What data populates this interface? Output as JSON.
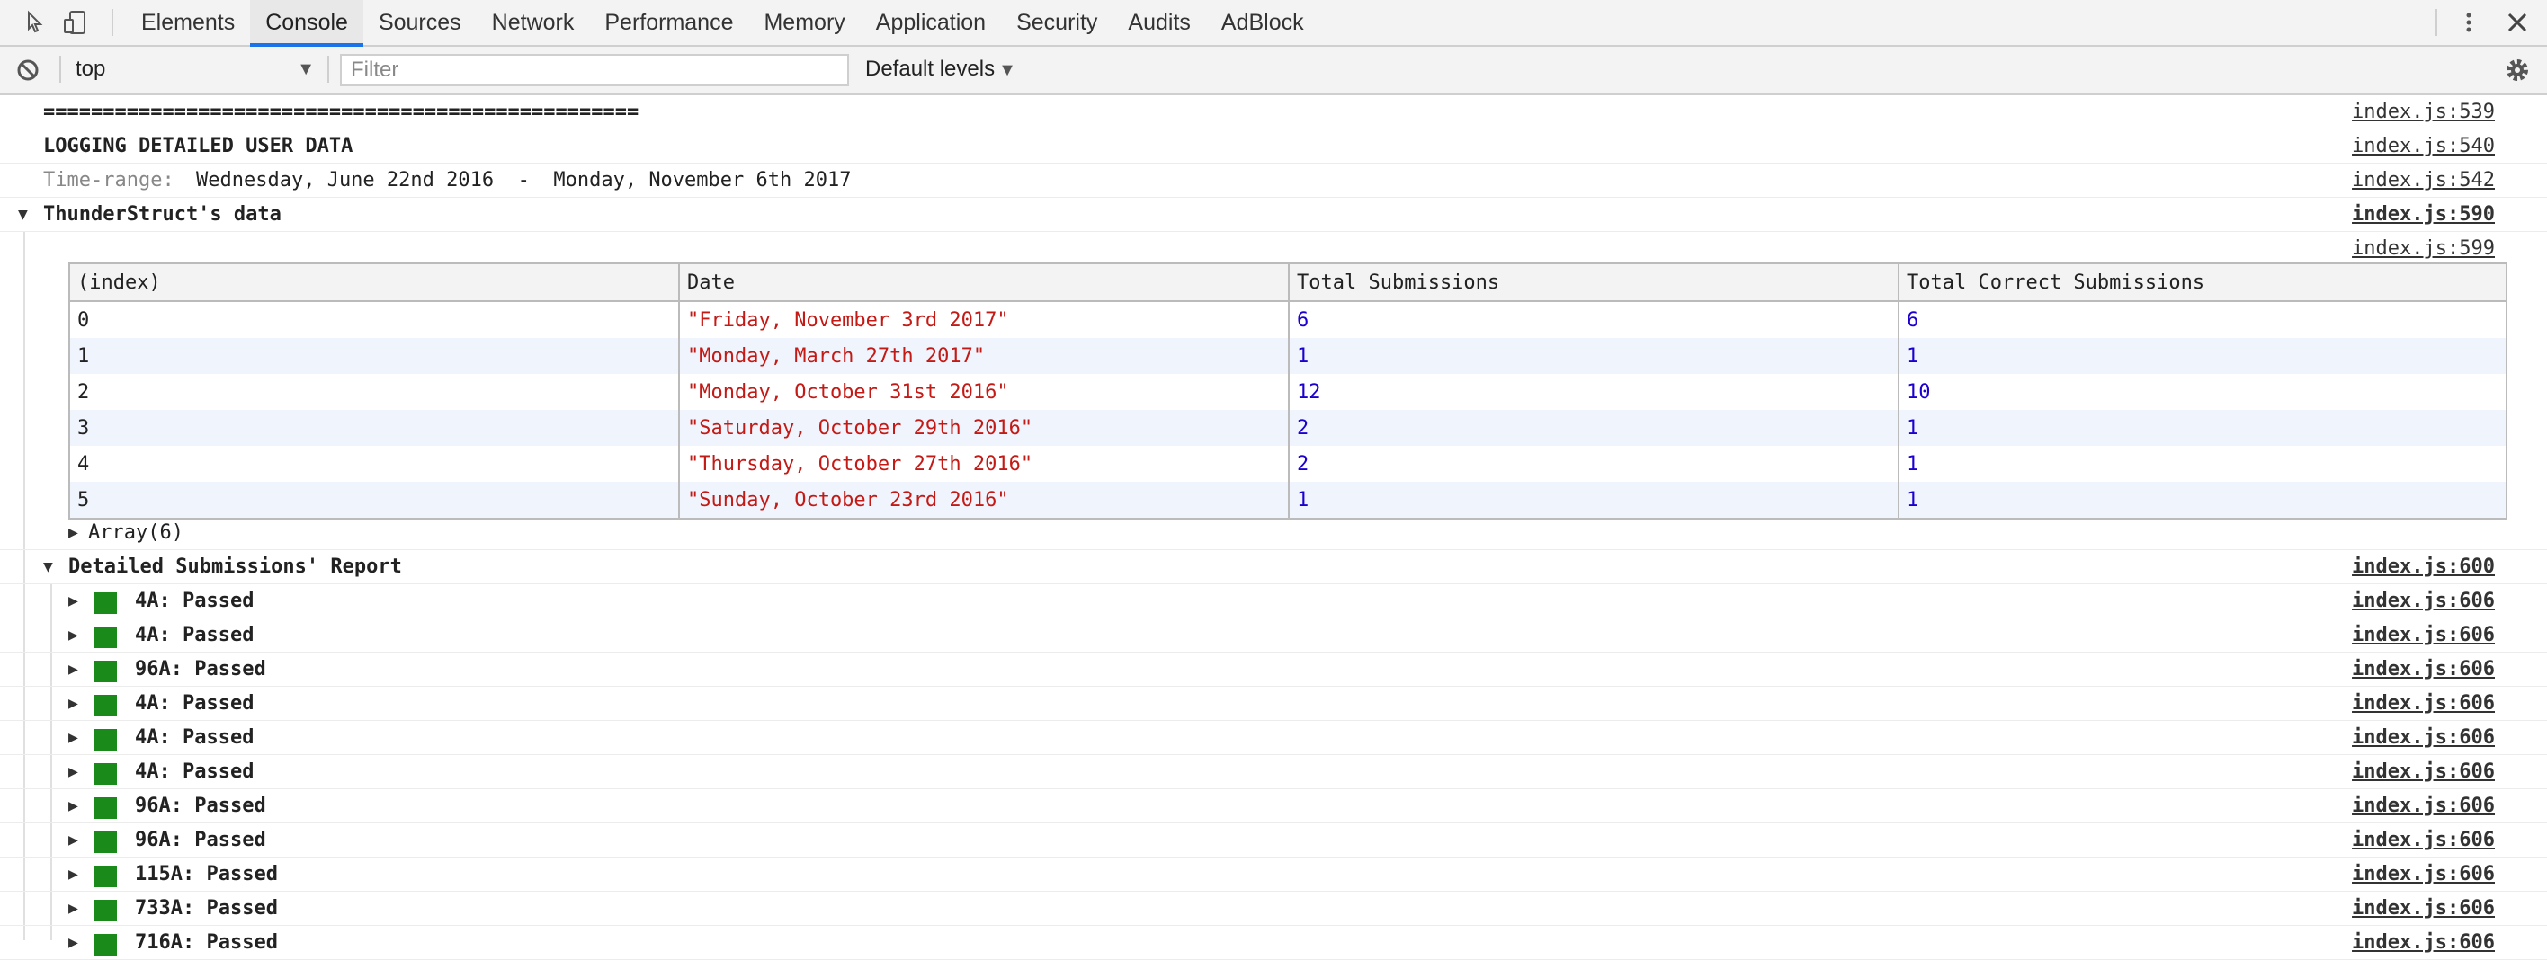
{
  "devtools": {
    "tabs": [
      "Elements",
      "Console",
      "Sources",
      "Network",
      "Performance",
      "Memory",
      "Application",
      "Security",
      "Audits",
      "AdBlock"
    ],
    "active_tab": "Console"
  },
  "toolbar": {
    "context": "top",
    "filter_placeholder": "Filter",
    "levels": "Default levels"
  },
  "console": {
    "line_separator": "==================================================",
    "heading": "LOGGING DETAILED USER DATA",
    "time_range_label": "Time-range:",
    "time_range_value": "Wednesday, June 22nd 2016  -  Monday, November 6th 2017",
    "group1_title": "ThunderStruct's data",
    "array_label": "Array(6)",
    "group2_title": "Detailed Submissions' Report",
    "sources": {
      "s539": "index.js:539",
      "s540": "index.js:540",
      "s542": "index.js:542",
      "s590": "index.js:590",
      "s599": "index.js:599",
      "s600": "index.js:600"
    }
  },
  "table": {
    "headers": [
      "(index)",
      "Date",
      "Total Submissions",
      "Total Correct Submissions"
    ],
    "rows": [
      {
        "index": "0",
        "date": "\"Friday, November 3rd 2017\"",
        "total": "6",
        "correct": "6"
      },
      {
        "index": "1",
        "date": "\"Monday, March 27th 2017\"",
        "total": "1",
        "correct": "1"
      },
      {
        "index": "2",
        "date": "\"Monday, October 31st 2016\"",
        "total": "12",
        "correct": "10"
      },
      {
        "index": "3",
        "date": "\"Saturday, October 29th 2016\"",
        "total": "2",
        "correct": "1"
      },
      {
        "index": "4",
        "date": "\"Thursday, October 27th 2016\"",
        "total": "2",
        "correct": "1"
      },
      {
        "index": "5",
        "date": "\"Sunday, October 23rd 2016\"",
        "total": "1",
        "correct": "1"
      }
    ]
  },
  "submissions": [
    {
      "label": "4A: Passed",
      "source": "index.js:606"
    },
    {
      "label": "4A: Passed",
      "source": "index.js:606"
    },
    {
      "label": "96A: Passed",
      "source": "index.js:606"
    },
    {
      "label": "4A: Passed",
      "source": "index.js:606"
    },
    {
      "label": "4A: Passed",
      "source": "index.js:606"
    },
    {
      "label": "4A: Passed",
      "source": "index.js:606"
    },
    {
      "label": "96A: Passed",
      "source": "index.js:606"
    },
    {
      "label": "96A: Passed",
      "source": "index.js:606"
    },
    {
      "label": "115A: Passed",
      "source": "index.js:606"
    },
    {
      "label": "733A: Passed",
      "source": "index.js:606"
    },
    {
      "label": "716A: Passed",
      "source": "index.js:606"
    }
  ],
  "colors": {
    "passed": "#1a8a1a",
    "string": "#c41a16",
    "number": "#1c00cf"
  }
}
